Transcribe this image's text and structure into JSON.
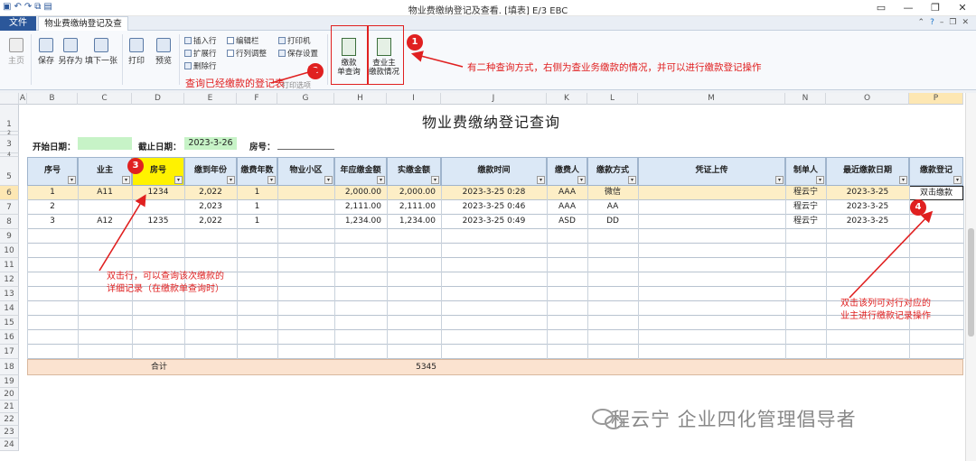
{
  "window": {
    "title": "物业费缴纳登记及查看. [填表]   E/3 EBC",
    "min_icon": "minimize-icon",
    "restore_icon": "restore-icon",
    "close_icon": "close-icon"
  },
  "tabs": {
    "file": "文件",
    "doc": "物业费缴纳登记及查看."
  },
  "ribbon": {
    "home": "主页",
    "save": "保存",
    "save_as": "另存为",
    "fill_next": "填下一张",
    "print": "打印",
    "preview": "预览",
    "insert_row": "插入行",
    "expand_row": "扩展行",
    "delete_row": "删除行",
    "edit_bar": "编辑栏",
    "row_col_adjust": "行列调整",
    "printer": "打印机",
    "save_settings": "保存设置",
    "print_options": "打印选项",
    "query1": "缴款单查询",
    "query1_a": "缴款",
    "query1_b": "单查询",
    "query2_a": "查业主",
    "query2_b": "缴款情况"
  },
  "sheet": {
    "columns": [
      "A",
      "B",
      "C",
      "D",
      "E",
      "F",
      "G",
      "H",
      "I",
      "J",
      "K",
      "L",
      "M",
      "N",
      "O",
      "P"
    ],
    "rows": [
      "1",
      "2",
      "3",
      "4",
      "5",
      "6",
      "7",
      "8",
      "9",
      "10",
      "11",
      "12",
      "13",
      "14",
      "15",
      "16",
      "17",
      "18",
      "19",
      "20",
      "21",
      "22",
      "23",
      "24"
    ],
    "title": "物业费缴纳登记查询",
    "start_date_label": "开始日期：",
    "start_date_value": "",
    "end_date_label": "截止日期：",
    "end_date_value": "2023-3-26",
    "room_label": "房号：",
    "room_value": ""
  },
  "table": {
    "headers": [
      "序号",
      "业主",
      "房号",
      "缴到年份",
      "缴费年数",
      "物业小区",
      "年应缴金额",
      "实缴金额",
      "缴款时间",
      "缴费人",
      "缴款方式",
      "凭证上传",
      "制单人",
      "最近缴款日期",
      "缴款登记"
    ],
    "rows": [
      [
        "1",
        "A11",
        "1234",
        "2,022",
        "1",
        "",
        "2,000.00",
        "2,000.00",
        "2023-3-25 0:28",
        "AAA",
        "微信",
        "",
        "程云宁",
        "2023-3-25",
        "双击缴款"
      ],
      [
        "2",
        "",
        "",
        "2,023",
        "1",
        "",
        "2,111.00",
        "2,111.00",
        "2023-3-25 0:46",
        "AAA",
        "AA",
        "",
        "程云宁",
        "2023-3-25",
        ""
      ],
      [
        "3",
        "A12",
        "1235",
        "2,022",
        "1",
        "",
        "1,234.00",
        "1,234.00",
        "2023-3-25 0:49",
        "ASD",
        "DD",
        "",
        "程云宁",
        "2023-3-25",
        ""
      ]
    ],
    "total_label": "合计",
    "total_value": "5345"
  },
  "annotations": {
    "n1": "1",
    "n2": "2",
    "n3": "3",
    "n4": "4",
    "note1": "有二种查询方式，右侧为查业务缴款的情况，并可以进行缴款登记操作",
    "note2": "查询已经缴款的登记表",
    "note3_a": "双击行，可以查询该次缴款的",
    "note3_b": "详细记录（在缴款单查询时）",
    "note4_a": "双击该列可对行对应的",
    "note4_b": "业主进行缴款记录操作"
  },
  "watermark": "程云宁 企业四化管理倡导者",
  "colors": {
    "accent": "#2b579a",
    "annotation_red": "#e02020",
    "header_fill": "#dbe8f6",
    "room_header": "#fff200",
    "selected_row": "#fdeec6",
    "total_row": "#fbe3d0"
  }
}
